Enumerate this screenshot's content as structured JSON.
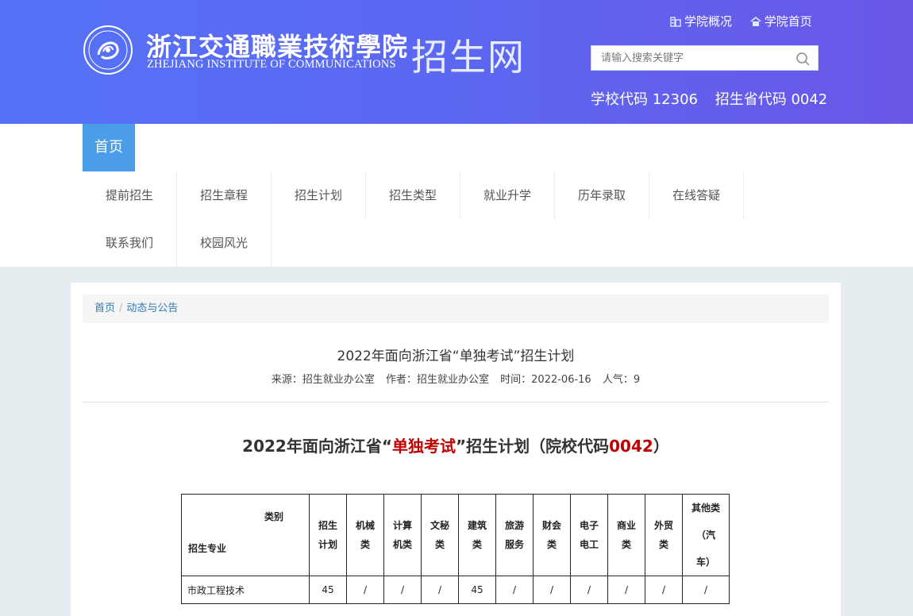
{
  "header": {
    "logo_cn": "浙江交通職業技術學院",
    "logo_en": "ZHEJIANG INSTITUTE OF COMMUNICATIONS",
    "site_name": "招生网",
    "links": [
      "学院概况",
      "学院首页"
    ],
    "search_placeholder": "请输入搜索关键字",
    "school_code": "学校代码 12306",
    "province_code": "招生省代码 0042"
  },
  "nav": {
    "home": "首页",
    "items": [
      "提前招生",
      "招生章程",
      "招生计划",
      "招生类型",
      "就业升学",
      "历年录取",
      "在线答疑",
      "联系我们",
      "校园风光"
    ]
  },
  "breadcrumb": [
    "首页",
    "动态与公告"
  ],
  "article": {
    "title": "2022年面向浙江省“单独考试”招生计划",
    "meta": {
      "source": "来源：招生就业办公室",
      "author": "作者：招生就业办公室",
      "time": "时间：2022-06-16",
      "views": "人气：9"
    },
    "heading_pre": "2022年面向浙江省“",
    "heading_red": "单独考试",
    "heading_mid": "”招生计划（院校代码",
    "heading_code": "0042",
    "heading_post": "）"
  },
  "table": {
    "corner_top": "类别",
    "corner_bottom": "招生专业",
    "columns": [
      [
        "招生",
        "计划"
      ],
      [
        "机械",
        "类"
      ],
      [
        "计算",
        "机类"
      ],
      [
        "文秘",
        "类"
      ],
      [
        "建筑",
        "类"
      ],
      [
        "旅游",
        "服务"
      ],
      [
        "财会",
        "类"
      ],
      [
        "电子",
        "电工"
      ],
      [
        "商业",
        "类"
      ],
      [
        "外贸",
        "类"
      ],
      [
        "其他类",
        "（汽",
        "车）"
      ]
    ],
    "rows": [
      {
        "major": "市政工程技术",
        "cells": [
          "45",
          "/",
          "/",
          "/",
          "45",
          "/",
          "/",
          "/",
          "/",
          "/",
          "/"
        ]
      }
    ]
  }
}
